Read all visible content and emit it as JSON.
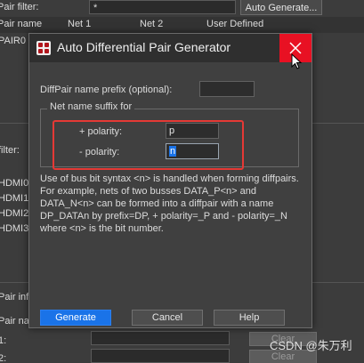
{
  "background": {
    "pair_filter_label": "Pair filter:",
    "pair_filter_value": "*",
    "auto_generate_label": "Auto Generate...",
    "columns": [
      "Pair name",
      "Net 1",
      "Net 2",
      "User Defined"
    ],
    "pair_row": "PAIR0",
    "filter_label": "filter:",
    "net_list": [
      "HDMI0",
      "HDMI1",
      "HDMI2",
      "HDMI3"
    ],
    "pair_info_label": "Pair info",
    "pair_name_label": "Pair na",
    "row1_label": "1:",
    "row2_label": "2:",
    "clear_label": "Clear"
  },
  "dialog": {
    "title": "Auto Differential Pair Generator",
    "prefix_label": "DiffPair name prefix (optional):",
    "prefix_value": "",
    "group_title": "Net name suffix for",
    "plus_label": "+ polarity:",
    "plus_value": "p",
    "minus_label": "- polarity:",
    "minus_value": "n",
    "help_text": "Use of bus bit syntax <n> is handled when forming diffpairs. For example, nets of two busses DATA_P<n> and DATA_N<n> can be formed into a diffpair with a name DP_DATAn by prefix=DP, + polarity=_P and - polarity=_N where <n> is the bit number.",
    "buttons": {
      "generate": "Generate",
      "cancel": "Cancel",
      "help": "Help"
    }
  },
  "watermark": "CSDN @朱万利",
  "colors": {
    "close": "#e81123",
    "primary": "#1a73e8",
    "highlight": "#e53935"
  }
}
